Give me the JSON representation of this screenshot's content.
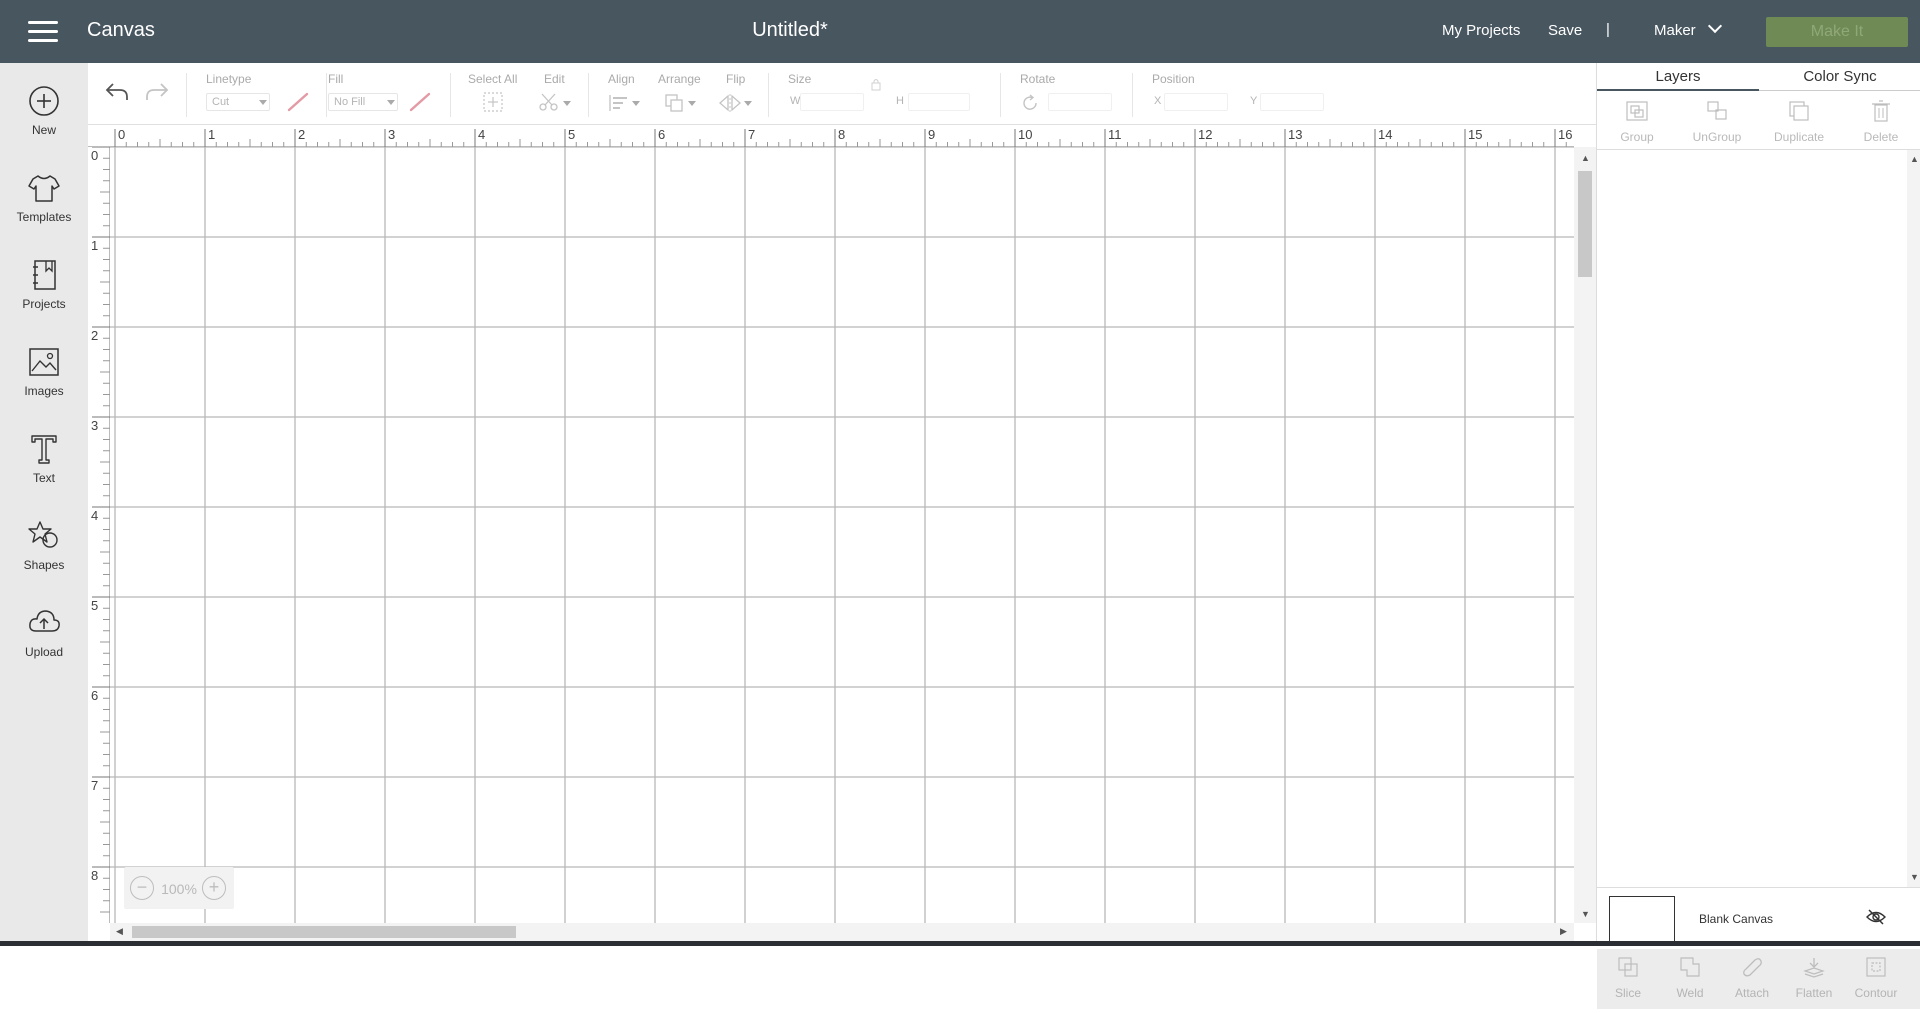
{
  "app": {
    "title": "Canvas",
    "document_title": "Untitled*"
  },
  "header": {
    "my_projects": "My Projects",
    "save": "Save",
    "separator": "|",
    "machine": "Maker",
    "make_it": "Make It"
  },
  "sidebar": {
    "items": [
      {
        "label": "New",
        "icon": "plus-circle-icon"
      },
      {
        "label": "Templates",
        "icon": "tshirt-icon"
      },
      {
        "label": "Projects",
        "icon": "notebook-icon"
      },
      {
        "label": "Images",
        "icon": "image-icon"
      },
      {
        "label": "Text",
        "icon": "text-icon"
      },
      {
        "label": "Shapes",
        "icon": "shapes-icon"
      },
      {
        "label": "Upload",
        "icon": "cloud-upload-icon"
      }
    ]
  },
  "toolbar": {
    "linetype_label": "Linetype",
    "linetype_value": "Cut",
    "fill_label": "Fill",
    "fill_value": "No Fill",
    "select_all_label": "Select All",
    "edit_label": "Edit",
    "align_label": "Align",
    "arrange_label": "Arrange",
    "flip_label": "Flip",
    "size_label": "Size",
    "width_label": "W",
    "height_label": "H",
    "rotate_label": "Rotate",
    "position_label": "Position",
    "x_label": "X",
    "y_label": "Y"
  },
  "rulers": {
    "top": [
      "0",
      "1",
      "2",
      "3",
      "4",
      "5",
      "6",
      "7",
      "8",
      "9",
      "10",
      "11",
      "12",
      "13",
      "14",
      "15",
      "16"
    ],
    "left": [
      "0",
      "1",
      "2",
      "3",
      "4",
      "5",
      "6",
      "7",
      "8"
    ]
  },
  "zoom": {
    "value": "100%",
    "minus": "−",
    "plus": "+"
  },
  "right_panel": {
    "tabs": [
      "Layers",
      "Color Sync"
    ],
    "top_actions": [
      "Group",
      "UnGroup",
      "Duplicate",
      "Delete"
    ],
    "canvas_label": "Blank Canvas",
    "bottom_actions": [
      "Slice",
      "Weld",
      "Attach",
      "Flatten",
      "Contour"
    ]
  },
  "colors": {
    "header_bg": "#485660",
    "make_it_bg": "#6f8a55",
    "sidebar_bg": "#e9e9ea",
    "grid_line": "#b8b8b8"
  }
}
